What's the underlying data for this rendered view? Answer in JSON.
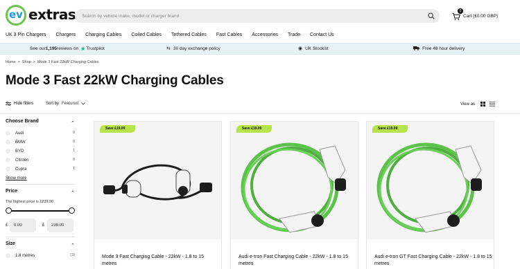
{
  "brand": {
    "logo_ev": "ev",
    "logo_text": "extras"
  },
  "search": {
    "placeholder": "Search by vehicle make, model or charger brand"
  },
  "cart": {
    "count": "0",
    "label": "Cart (£0.00 GBP)"
  },
  "nav": [
    "UK 3 Pin Chargers",
    "Chargers",
    "Charging Cables",
    "Coiled Cables",
    "Tethered Cables",
    "Fast Cables",
    "Accessories",
    "Trade",
    "Contact Us"
  ],
  "usp": {
    "reviews_prefix": "See our ",
    "reviews_count": "1,195",
    "reviews_suffix": " reviews on",
    "trustpilot": "Trustpilot",
    "exchange": "30 day exchange policy",
    "stockist": "UK Stockist",
    "delivery": "Free 48 hour delivery"
  },
  "breadcrumb": [
    "Home",
    ">",
    "Shop",
    ">",
    "Mode 3 Fast 22kW Charging Cables"
  ],
  "page_title": "Mode 3 Fast 22kW Charging Cables",
  "toolbar": {
    "hide_filters": "Hide filters",
    "sort_label": "Sort by",
    "sort_value": "Featured",
    "view_as": "View as"
  },
  "filters": {
    "brand_heading": "Choose Brand",
    "brands": [
      {
        "name": "Audi",
        "count": "9"
      },
      {
        "name": "BMW",
        "count": "8"
      },
      {
        "name": "BYD",
        "count": "1"
      },
      {
        "name": "Citroen",
        "count": "8"
      },
      {
        "name": "Cupra",
        "count": "1"
      }
    ],
    "show_more": "Show more",
    "price_heading": "Price",
    "price_note": "The highest price is £239.00",
    "currency": "£",
    "price_min": "0.00",
    "price_max": "239.00",
    "size_heading": "Size",
    "sizes": [
      {
        "name": "1.8 metres",
        "count": "(3)"
      }
    ]
  },
  "products": [
    {
      "badge": "Save £19.00",
      "name": "Mode 3 Fast Charging Cable - 22kW - 1.8 to 15 metres",
      "cable_color": "#1d1d1d"
    },
    {
      "badge": "Save £19.00",
      "name": "Audi e-tron Fast Charging Cable - 22kW - 1.8 to 15 metres",
      "cable_color": "#5cc24a"
    },
    {
      "badge": "Save £19.00",
      "name": "Audi e-tron GT Fast Charging Cable - 22kW - 1.8 to 15 metres",
      "cable_color": "#5cc24a"
    }
  ],
  "colors": {
    "accent_green": "#b6e44a",
    "usp_bar": "#e6f2f8",
    "trustpilot_green": "#00b67a"
  }
}
